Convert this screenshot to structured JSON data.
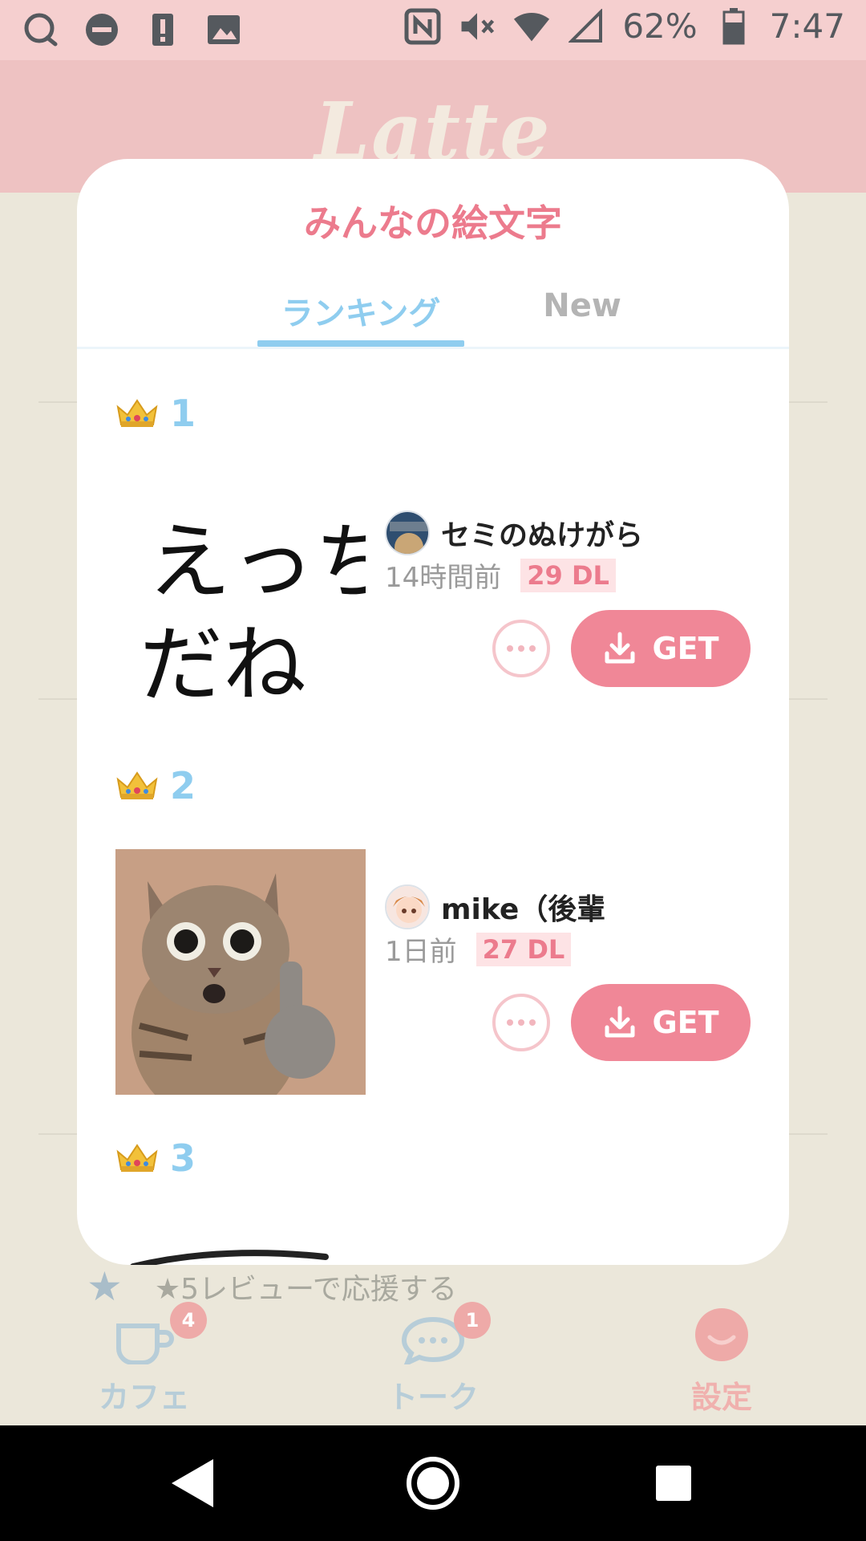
{
  "status_bar": {
    "battery": "62%",
    "time": "7:47",
    "left_icons": [
      "chat-bubble-icon",
      "do-not-disturb-icon",
      "alert-icon",
      "image-icon"
    ],
    "right_icons": [
      "nfc-icon",
      "mute-icon",
      "wifi-icon",
      "cellular-icon",
      "battery-icon"
    ]
  },
  "app": {
    "logo": "Latte",
    "background_review_text": "★5レビューで応援する"
  },
  "modal": {
    "title": "みんなの絵文字",
    "tabs": [
      {
        "label": "ランキング",
        "active": true
      },
      {
        "label": "New",
        "active": false
      }
    ],
    "items": [
      {
        "rank": "1",
        "emoji_text_line1": "えっち",
        "emoji_text_line2": "だね",
        "author": "セミのぬけがら",
        "time": "14時間前",
        "downloads": "29 DL",
        "get_label": "GET"
      },
      {
        "rank": "2",
        "emoji_description_icon": "cat-middle-finger-image",
        "author": "mike（後輩",
        "time": "1日前",
        "downloads": "27 DL",
        "get_label": "GET"
      },
      {
        "rank": "3"
      }
    ]
  },
  "bottom_tabs": [
    {
      "label": "カフェ",
      "badge": "4",
      "icon": "coffee-cup-icon"
    },
    {
      "label": "トーク",
      "badge": "1",
      "icon": "chat-icon"
    },
    {
      "label": "設定",
      "icon": "avatar-icon"
    }
  ],
  "colors": {
    "accent_pink": "#ec7b8d",
    "accent_blue": "#8fcdef",
    "get_button": "#f08797"
  }
}
